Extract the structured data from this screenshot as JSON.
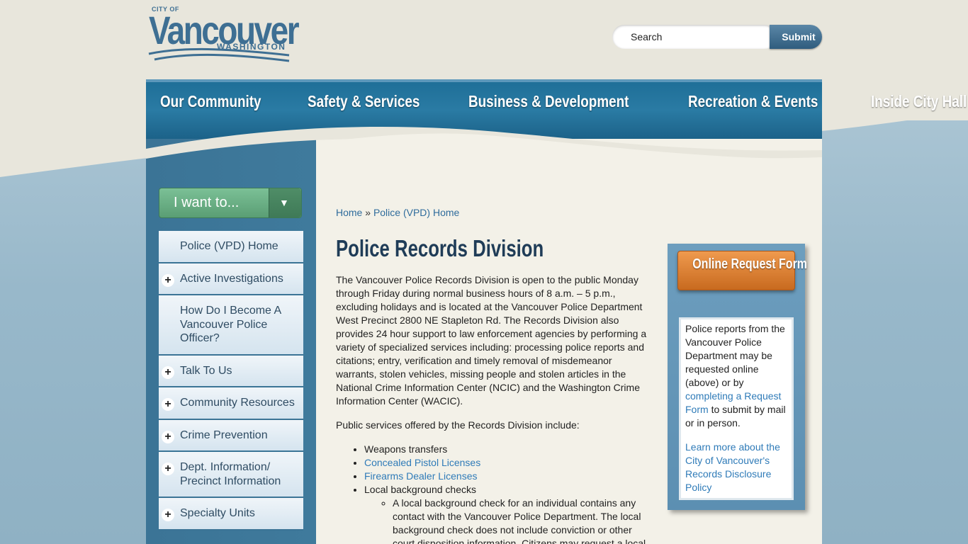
{
  "logo": {
    "city_of": "CITY OF",
    "name": "Vancouver",
    "state": "WASHINGTON"
  },
  "search": {
    "placeholder": "Search",
    "submit_label": "Submit"
  },
  "nav": {
    "items": [
      "Our Community",
      "Safety & Services",
      "Business & Development",
      "Recreation & Events",
      "Inside City Hall"
    ]
  },
  "sidebar": {
    "iwant_label": "I want to...",
    "items": [
      {
        "label": "Police (VPD) Home",
        "expandable": false
      },
      {
        "label": "Active Investigations",
        "expandable": true
      },
      {
        "label": "How Do I Become A Vancouver Police Officer?",
        "expandable": false
      },
      {
        "label": "Talk To Us",
        "expandable": true
      },
      {
        "label": "Community Resources",
        "expandable": true
      },
      {
        "label": "Crime Prevention",
        "expandable": true
      },
      {
        "label": "Dept. Information/ Precinct Information",
        "expandable": true
      },
      {
        "label": "Specialty Units",
        "expandable": true
      }
    ]
  },
  "breadcrumb": {
    "home": "Home",
    "separator": "»",
    "current": "Police (VPD) Home"
  },
  "page": {
    "title": "Police Records Division",
    "intro": "The Vancouver Police Records Division is open to the public Monday through Friday during normal business hours of 8 a.m. – 5 p.m., excluding holidays and is located at the Vancouver Police Department West Precinct 2800 NE Stapleton Rd. The Records Division also provides 24 hour support to law enforcement agencies by performing a variety of specialized services including: processing police reports and citations; entry, verification and timely removal of misdemeanor warrants, stolen vehicles, missing people and stolen articles in the National Crime Information Center (NCIC) and the Washington Crime Information Center (WACIC).",
    "services_heading": "Public services offered by the Records Division include:",
    "services": [
      {
        "label": "Weapons transfers",
        "link": false
      },
      {
        "label": "Concealed Pistol Licenses",
        "link": true
      },
      {
        "label": "Firearms Dealer Licenses",
        "link": true
      },
      {
        "label": "Local background checks",
        "link": false
      }
    ],
    "background_note": "A local background check for an individual contains any contact with the Vancouver Police Department. The local background check does not include conviction or other court disposition information. Citizens may request a local"
  },
  "aside": {
    "button_label": "Online Request Form",
    "text_before": "Police reports from the Vancouver Police Department may be requested online (above) or by",
    "link1": "completing a Request Form",
    "text_after": "to submit by mail or in person.",
    "link2": "Learn more about the City of Vancouver's Records Disclosure Policy"
  },
  "colors": {
    "nav_blue": "#1f6f98",
    "sidebar_blue": "#3b7496",
    "iwant_green": "#6aae83",
    "request_orange": "#e0873a",
    "link": "#2f7bb8"
  }
}
